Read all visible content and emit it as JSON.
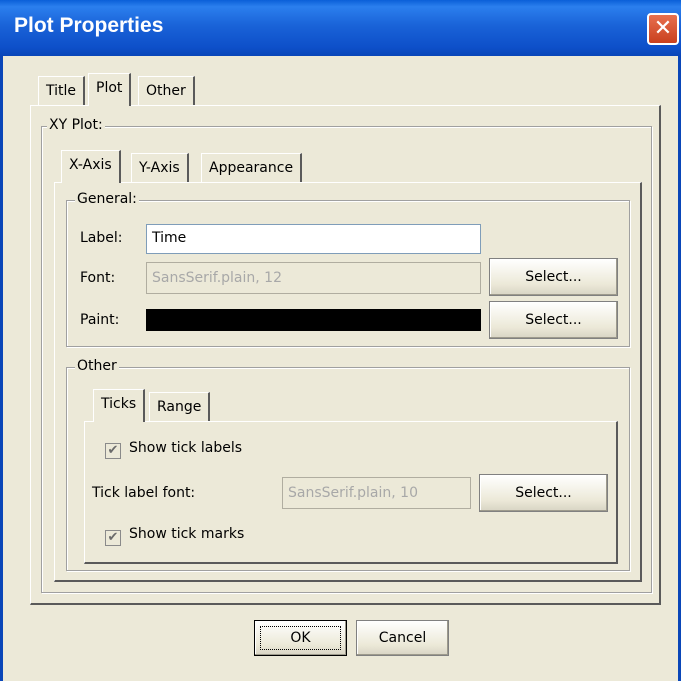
{
  "window": {
    "title": "Plot Properties",
    "close_glyph": "✕"
  },
  "main_tabs": [
    "Title",
    "Plot",
    "Other"
  ],
  "xy_plot": {
    "legend": "XY Plot:",
    "tabs": [
      "X-Axis",
      "Y-Axis",
      "Appearance"
    ],
    "general": {
      "legend": "General:",
      "label_label": "Label:",
      "label_value": "Time",
      "font_label": "Font:",
      "font_value": "SansSerif.plain, 12",
      "font_button": "Select...",
      "paint_label": "Paint:",
      "paint_color": "#000000",
      "paint_button": "Select..."
    },
    "other": {
      "legend": "Other",
      "tabs": [
        "Ticks",
        "Range"
      ],
      "show_tick_labels": "Show tick labels",
      "tick_label_font_label": "Tick label font:",
      "tick_label_font_value": "SansSerif.plain, 10",
      "tick_font_button": "Select...",
      "show_tick_marks": "Show tick marks"
    }
  },
  "buttons": {
    "ok": "OK",
    "cancel": "Cancel"
  }
}
